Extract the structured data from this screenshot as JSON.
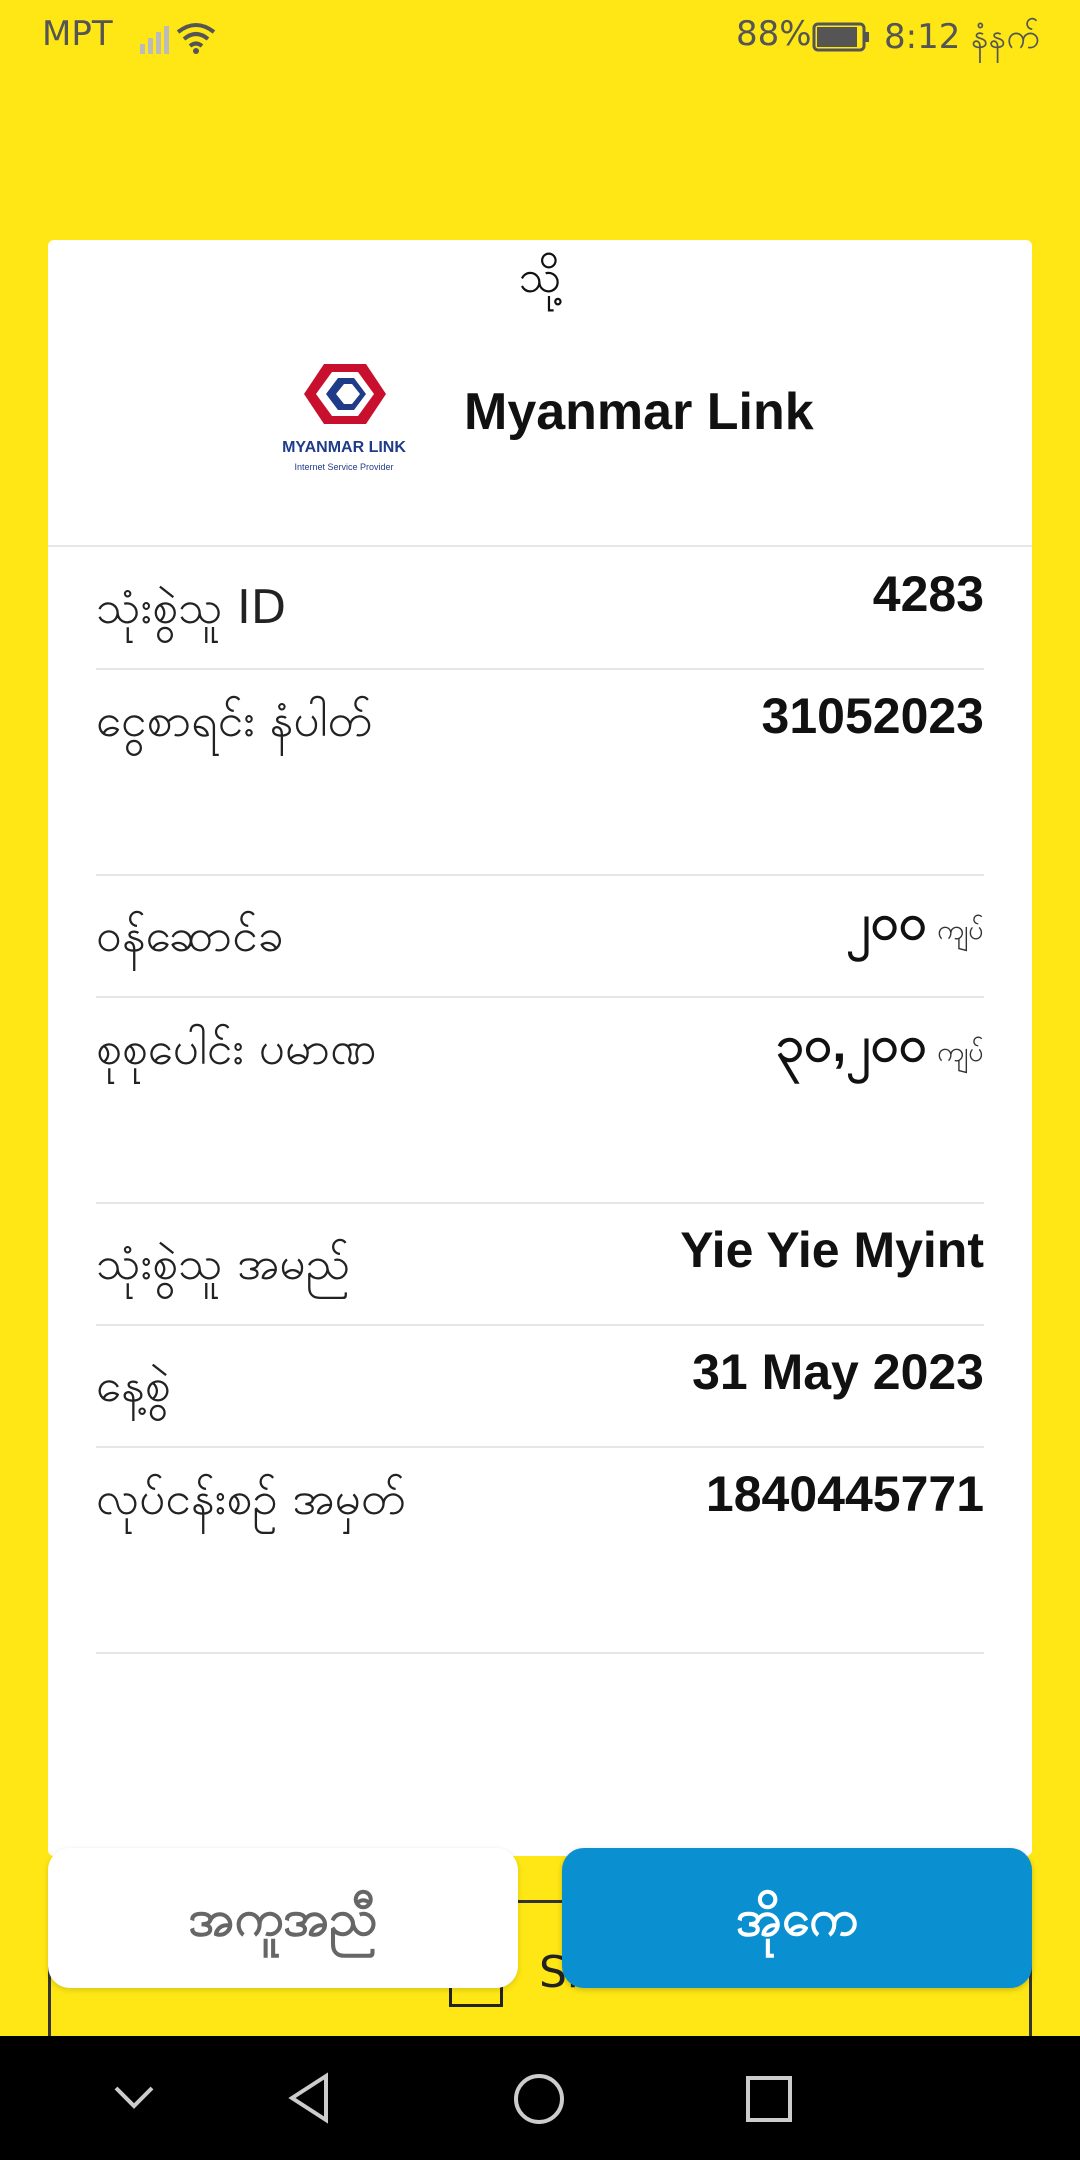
{
  "status_bar": {
    "carrier": "MPT",
    "battery": "88%",
    "time": "8:12 နံနက်",
    "icons": [
      "signal-icon",
      "wifi-icon",
      "battery-icon"
    ]
  },
  "receipt": {
    "to_label": "သို့",
    "merchant_name": "Myanmar Link",
    "logo_text": "MYANMAR LINK",
    "logo_subtext": "Internet Service Provider",
    "rows": [
      {
        "label": "သုံးစွဲသူ ID",
        "value": "4283"
      },
      {
        "label": "ငွေစာရင်း နံပါတ်",
        "value": "31052023"
      },
      {
        "label": "ဝန်ဆောင်ခ",
        "value": "၂၀၀",
        "unit": "ကျပ်"
      },
      {
        "label": "စုစုပေါင်း ပမာဏ",
        "value": "၃၀,၂၀၀",
        "unit": "ကျပ်"
      },
      {
        "label": "သုံးစွဲသူ အမည်",
        "value": "Yie Yie Myint"
      },
      {
        "label": "နေ့စွဲ",
        "value": "31 May 2023"
      },
      {
        "label": "လုပ်ငန်းစဉ် အမှတ်",
        "value": "1840445771"
      }
    ]
  },
  "share": {
    "label": "Share"
  },
  "buttons": {
    "help": "အကူအညီ",
    "ok": "အိုကေ"
  },
  "colors": {
    "background": "#FEE714",
    "primary": "#0A8FD1"
  }
}
